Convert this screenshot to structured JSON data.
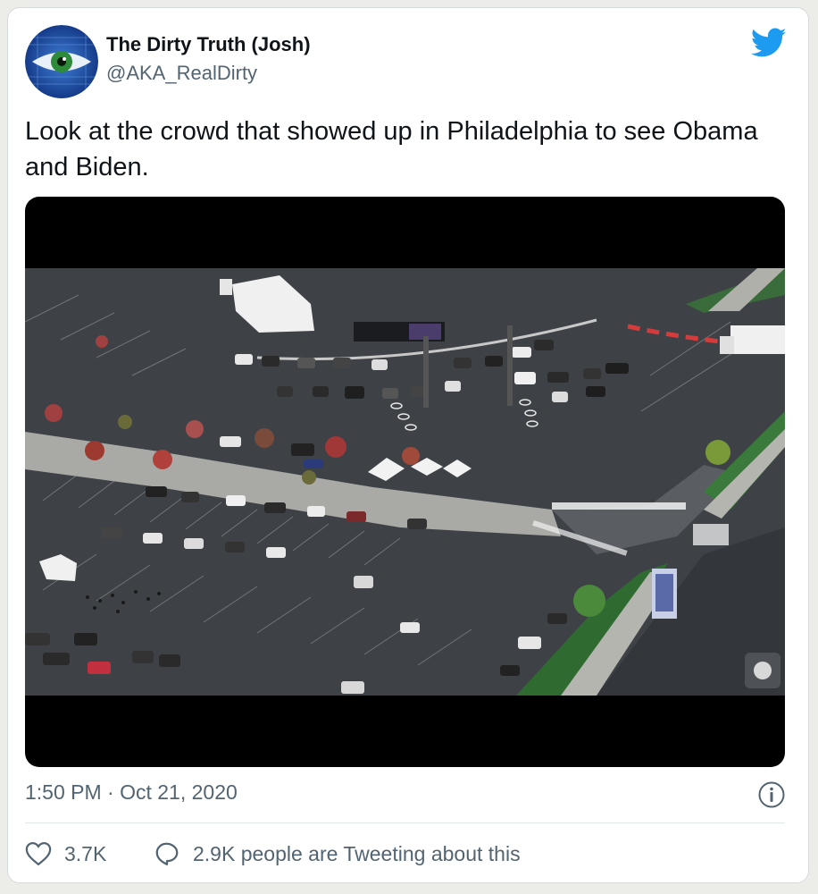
{
  "tweet": {
    "author": {
      "display_name": "The Dirty Truth (Josh)",
      "handle": "@AKA_RealDirty",
      "avatar_icon": "eye-avatar"
    },
    "text": "Look at the crowd that showed up in Philadelphia to see Obama and Biden.",
    "timestamp": "1:50 PM · Oct 21, 2020",
    "likes": "3.7K",
    "retweet_summary": "2.9K people are Tweeting about this",
    "brand_color": "#1d9bf0",
    "media": {
      "type": "video",
      "description_icon": "aerial-parking-lot-video"
    }
  }
}
